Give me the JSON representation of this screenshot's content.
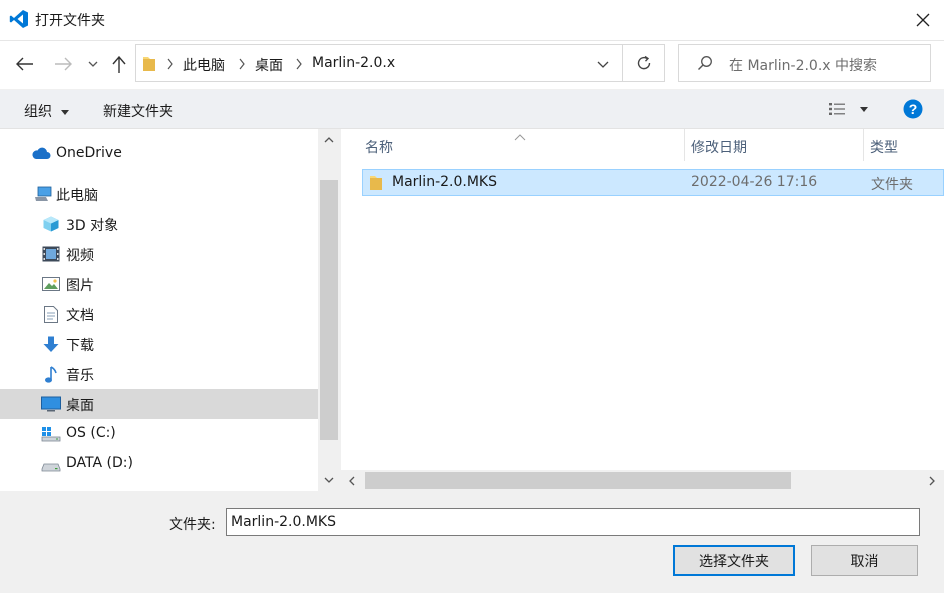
{
  "window": {
    "title": "打开文件夹"
  },
  "breadcrumb": [
    "此电脑",
    "桌面",
    "Marlin-2.0.x"
  ],
  "search": {
    "placeholder": "在 Marlin-2.0.x 中搜索"
  },
  "toolbar": {
    "organize": "组织",
    "new_folder": "新建文件夹"
  },
  "sidebar": {
    "items": [
      {
        "label": "OneDrive",
        "icon": "cloud-icon"
      },
      {
        "label": "此电脑",
        "icon": "computer-icon"
      },
      {
        "label": "3D 对象",
        "icon": "cube-icon"
      },
      {
        "label": "视频",
        "icon": "video-icon"
      },
      {
        "label": "图片",
        "icon": "picture-icon"
      },
      {
        "label": "文档",
        "icon": "document-icon"
      },
      {
        "label": "下载",
        "icon": "download-icon"
      },
      {
        "label": "音乐",
        "icon": "music-icon"
      },
      {
        "label": "桌面",
        "icon": "desktop-icon",
        "selected": true
      },
      {
        "label": "OS (C:)",
        "icon": "windows-drive-icon"
      },
      {
        "label": "DATA (D:)",
        "icon": "drive-icon"
      }
    ]
  },
  "columns": {
    "name": "名称",
    "date": "修改日期",
    "type": "类型"
  },
  "files": [
    {
      "name": "Marlin-2.0.MKS",
      "date": "2022-04-26 17:16",
      "type": "文件夹"
    }
  ],
  "footer": {
    "folder_label": "文件夹:",
    "folder_value": "Marlin-2.0.MKS",
    "select_button": "选择文件夹",
    "cancel_button": "取消"
  },
  "colors": {
    "accent": "#0078d7",
    "selection": "#cce8ff",
    "folder": "#f8d775"
  }
}
